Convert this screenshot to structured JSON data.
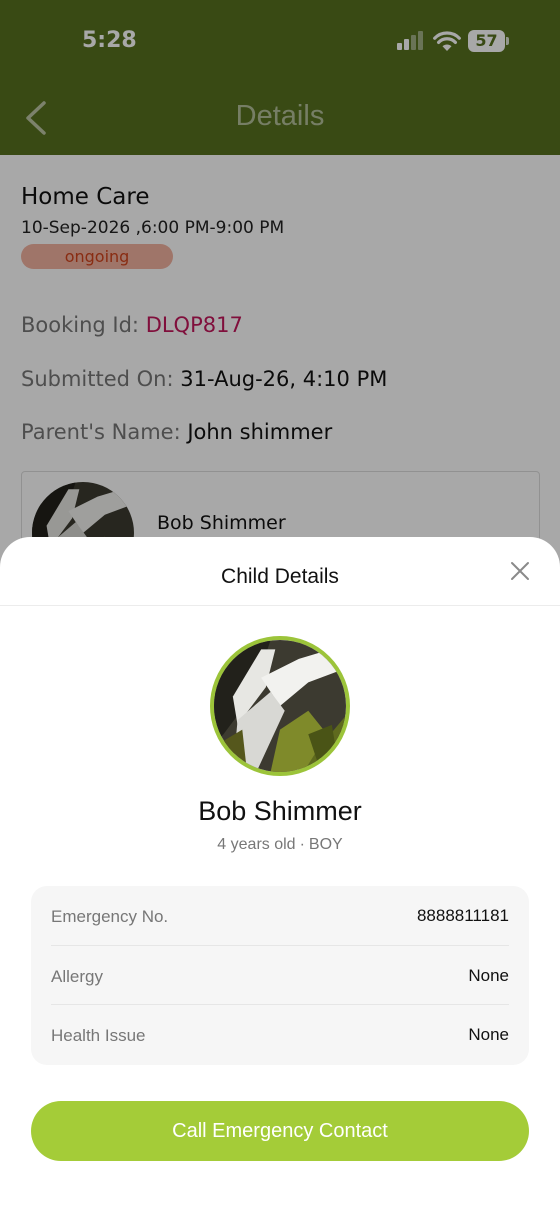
{
  "status_bar": {
    "time": "5:28",
    "battery": "57"
  },
  "nav": {
    "title": "Details",
    "back_icon": "chevron-left-icon"
  },
  "booking": {
    "service": "Home Care",
    "datetime": "10-Sep-2026 ,6:00 PM-9:00 PM",
    "status": "ongoing",
    "booking_id_label": "Booking Id: ",
    "booking_id": "DLQP817",
    "submitted_label": "Submitted On: ",
    "submitted": "31-Aug-26, 4:10 PM",
    "parent_label": "Parent's Name: ",
    "parent": "John shimmer",
    "child_card_name": "Bob Shimmer"
  },
  "sheet": {
    "title": "Child Details",
    "close_icon": "close-icon",
    "child_name": "Bob Shimmer",
    "age": "4 years old",
    "separator": "·",
    "gender": "BOY",
    "details": [
      {
        "label": "Emergency No.",
        "value": "8888811181"
      },
      {
        "label": "Allergy",
        "value": "None"
      },
      {
        "label": "Health Issue",
        "value": "None"
      }
    ],
    "call_button": "Call Emergency Contact"
  },
  "colors": {
    "header": "#57711f",
    "accent_green": "#a4cc38",
    "avatar_ring": "#9cc43a",
    "booking_id": "#c2185b",
    "status_badge_bg": "#f1b2a0",
    "status_badge_text": "#d0441c"
  }
}
